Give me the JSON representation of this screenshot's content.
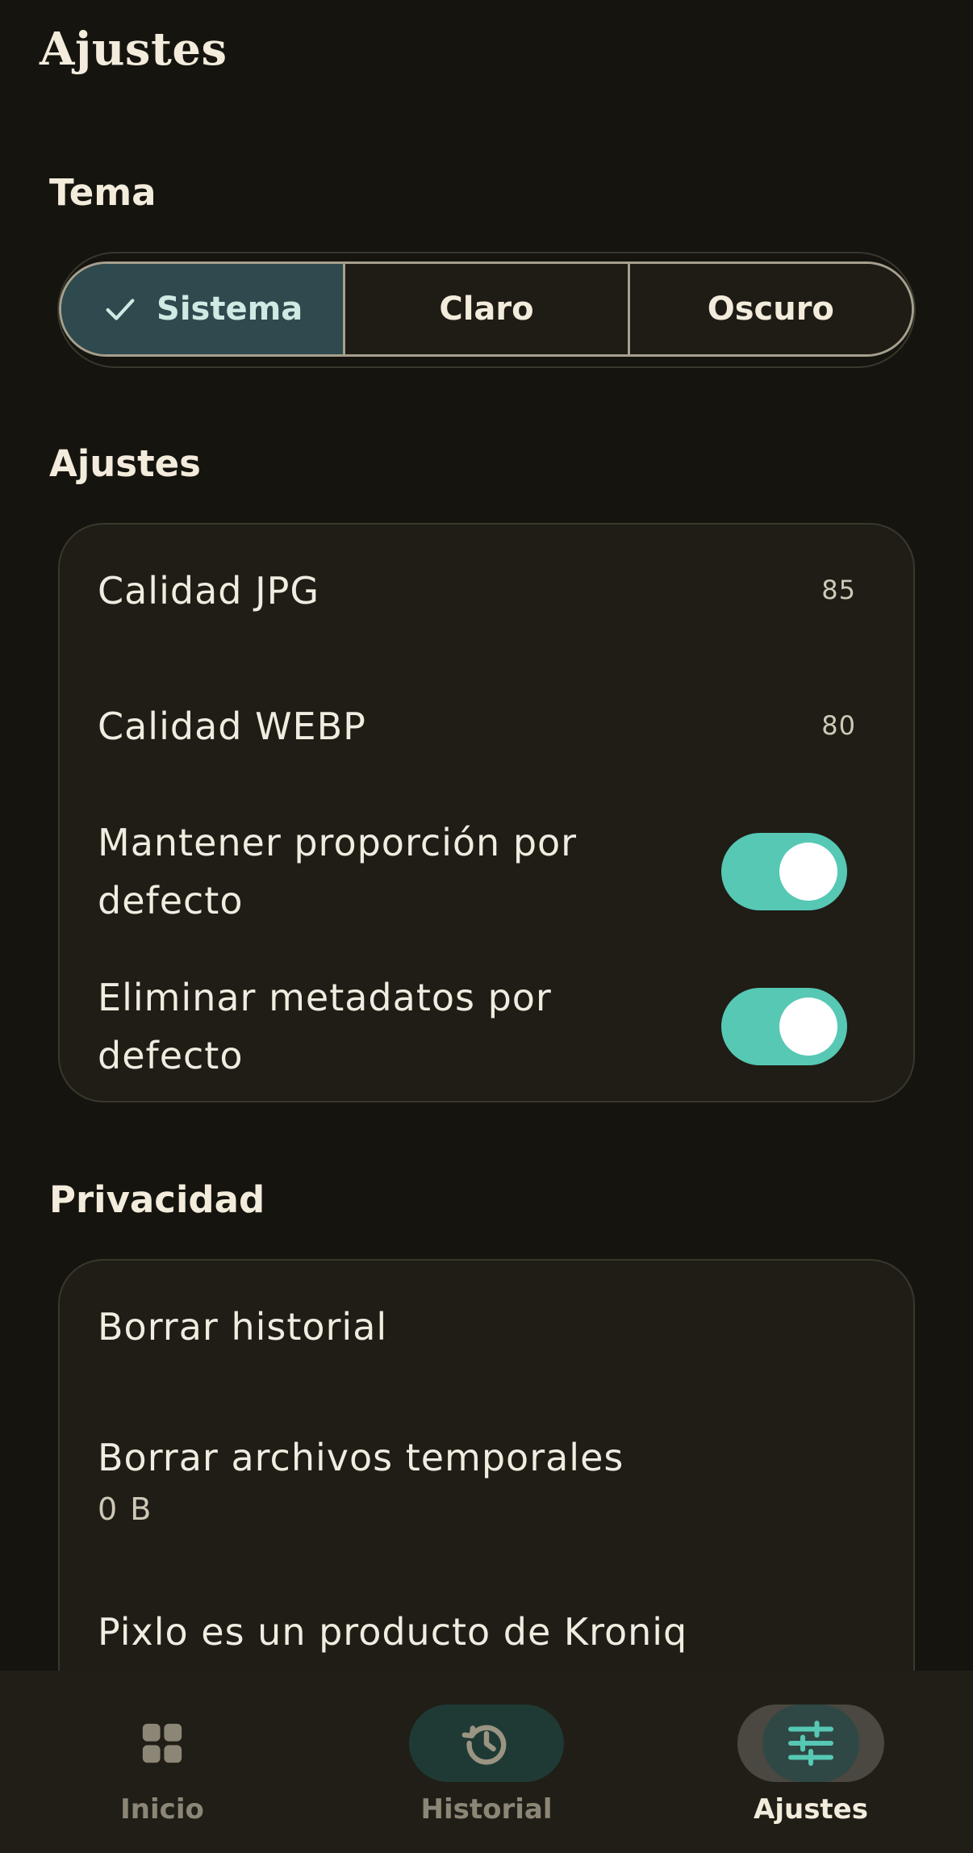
{
  "header": {
    "title": "Ajustes"
  },
  "theme": {
    "section_title": "Tema",
    "options": [
      {
        "label": "Sistema",
        "selected": true
      },
      {
        "label": "Claro",
        "selected": false
      },
      {
        "label": "Oscuro",
        "selected": false
      }
    ]
  },
  "settings": {
    "section_title": "Ajustes",
    "jpg_quality": {
      "label": "Calidad JPG",
      "value": "85"
    },
    "webp_quality": {
      "label": "Calidad WEBP",
      "value": "80"
    },
    "keep_ratio": {
      "label_line1": "Mantener proporción por",
      "label_line2": "defecto",
      "enabled": true
    },
    "strip_metadata": {
      "label_line1": "Eliminar metadatos por",
      "label_line2": "defecto",
      "enabled": true
    }
  },
  "privacy": {
    "section_title": "Privacidad",
    "clear_history": {
      "label": "Borrar historial"
    },
    "clear_temp": {
      "label": "Borrar archivos temporales",
      "size": "0 B"
    },
    "about": {
      "label": "Pixlo es un producto de Kroniq"
    }
  },
  "bottom_nav": {
    "items": [
      {
        "label": "Inicio",
        "icon": "grid-icon",
        "active": false
      },
      {
        "label": "Historial",
        "icon": "history-icon",
        "active": false
      },
      {
        "label": "Ajustes",
        "icon": "sliders-icon",
        "active": true
      }
    ]
  },
  "colors": {
    "background": "#15140f",
    "card": "#1f1d16",
    "accent": "#56c8b4",
    "selected_segment": "#2e4a4e"
  }
}
